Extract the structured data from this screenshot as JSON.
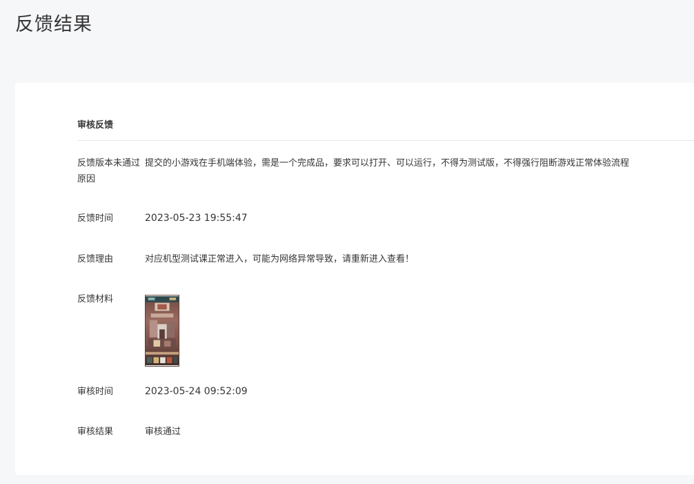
{
  "page": {
    "title": "反馈结果"
  },
  "section": {
    "title": "审核反馈"
  },
  "rows": {
    "version_reason": {
      "label": "反馈版本未通过原因",
      "value": "提交的小游戏在手机端体验，需是一个完成品，要求可以打开、可以运行，不得为测试版，不得强行阻断游戏正常体验流程"
    },
    "feedback_time": {
      "label": "反馈时间",
      "value": "2023-05-23 19:55:47"
    },
    "feedback_reason": {
      "label": "反馈理由",
      "value": "对应机型测试课正常进入，可能为网络异常导致，请重新进入查看！"
    },
    "feedback_material": {
      "label": "反馈材料"
    },
    "review_time": {
      "label": "审核时间",
      "value": "2023-05-24 09:52:09"
    },
    "review_result": {
      "label": "审核结果",
      "value": "审核通过"
    }
  },
  "colors": {
    "background": "#f6f7f9",
    "card": "#ffffff",
    "text": "#353535",
    "divider": "#e7e7eb"
  }
}
